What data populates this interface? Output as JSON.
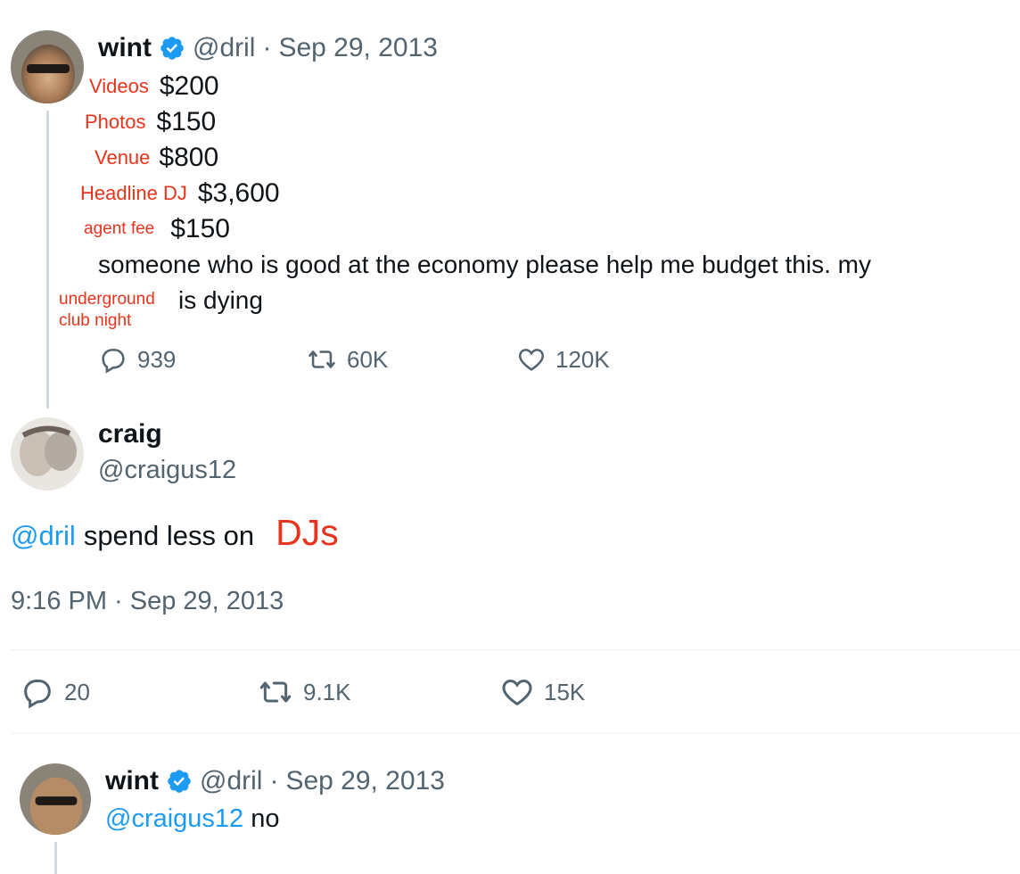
{
  "tweet1": {
    "name": "wint",
    "handle": "@dril",
    "sep": "·",
    "date": "Sep 29, 2013",
    "budget": [
      {
        "label": "Videos",
        "amount": "$200"
      },
      {
        "label": "Photos",
        "amount": "$150"
      },
      {
        "label": "Venue",
        "amount": "$800"
      },
      {
        "label": "Headline DJ",
        "amount": "$3,600"
      },
      {
        "label": "agent fee",
        "amount": "$150"
      }
    ],
    "text_line1": "someone who is good at the economy please help me budget this. my",
    "inserted_label_line1": "underground",
    "inserted_label_line2": "club night",
    "text_line2": "is dying",
    "replies": "939",
    "retweets": "60K",
    "likes": "120K"
  },
  "tweet2": {
    "name": "craig",
    "handle": "@craigus12",
    "mention": "@dril",
    "text": "spend less on",
    "highlight": "DJs",
    "timestamp": "9:16 PM · Sep 29, 2013",
    "replies": "20",
    "retweets": "9.1K",
    "likes": "15K"
  },
  "tweet3": {
    "name": "wint",
    "handle": "@dril",
    "sep": "·",
    "date": "Sep 29, 2013",
    "mention": "@craigus12",
    "text": "no"
  },
  "colors": {
    "accent": "#1d9bf0",
    "annotation_red": "#e8341c",
    "muted": "#536471",
    "divider": "#eff3f4"
  },
  "icons": [
    "verified-badge-icon",
    "reply-icon",
    "retweet-icon",
    "like-icon"
  ]
}
